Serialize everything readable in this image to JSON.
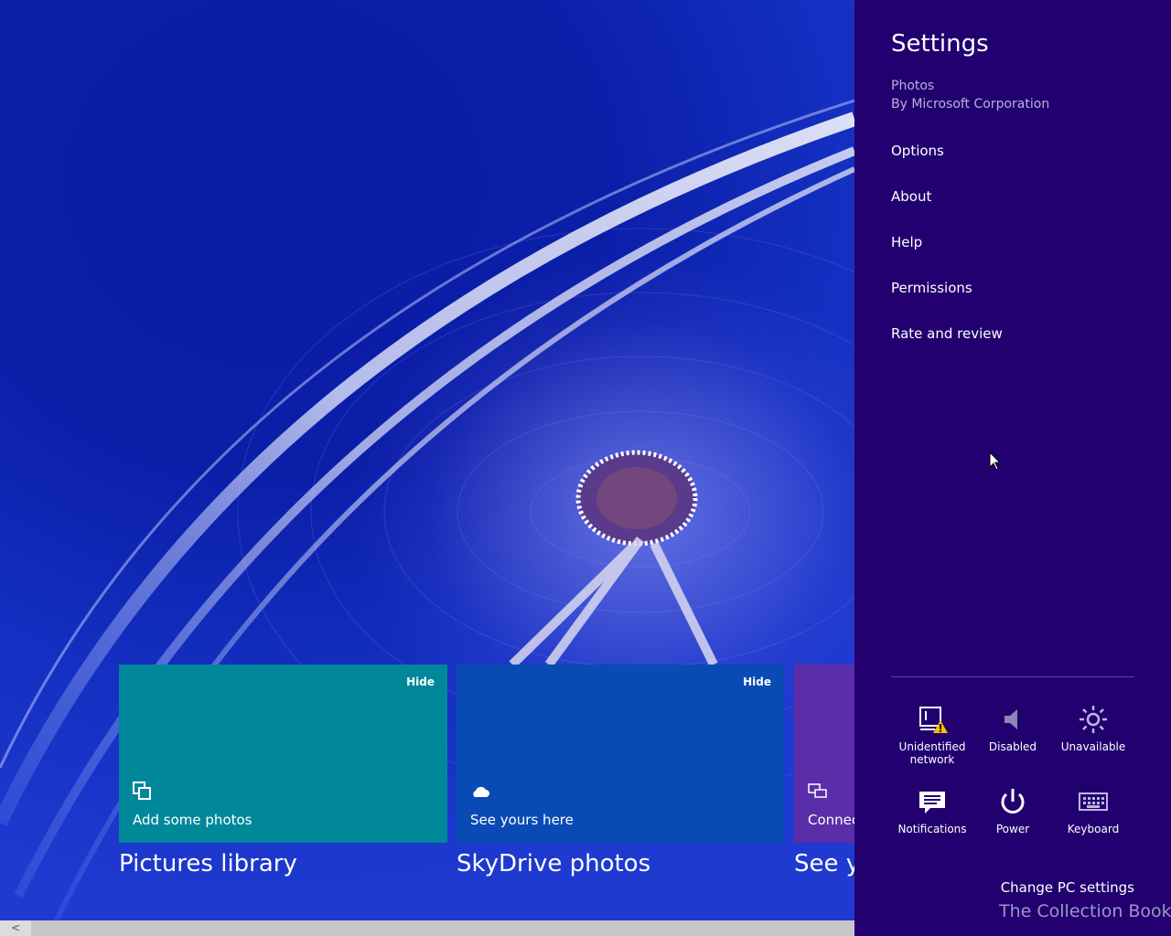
{
  "tiles": [
    {
      "hide_label": "Hide",
      "label": "Add some photos",
      "caption": "Pictures library",
      "color": "#00889a",
      "icon": "photos-icon"
    },
    {
      "hide_label": "Hide",
      "label": "See yours here",
      "caption": "SkyDrive photos",
      "color": "#0a4ab5",
      "icon": "cloud-icon"
    },
    {
      "label": "Connec",
      "caption": "See yo",
      "color": "#5a2ea8",
      "icon": "devices-icon"
    }
  ],
  "settings": {
    "title": "Settings",
    "app_name": "Photos",
    "publisher": "By Microsoft Corporation",
    "menu": [
      "Options",
      "About",
      "Help",
      "Permissions",
      "Rate and review"
    ],
    "quick_settings": [
      {
        "label": "Unidentified network",
        "icon": "network-warning-icon"
      },
      {
        "label": "Disabled",
        "icon": "speaker-icon"
      },
      {
        "label": "Unavailable",
        "icon": "brightness-icon"
      },
      {
        "label": "Notifications",
        "icon": "notifications-icon"
      },
      {
        "label": "Power",
        "icon": "power-icon"
      },
      {
        "label": "Keyboard",
        "icon": "keyboard-icon"
      }
    ],
    "change_pc_settings": "Change PC settings",
    "background_color": "#22006f"
  },
  "watermark": "The Collection Book",
  "scrollbar": {
    "left_arrow": "<"
  }
}
